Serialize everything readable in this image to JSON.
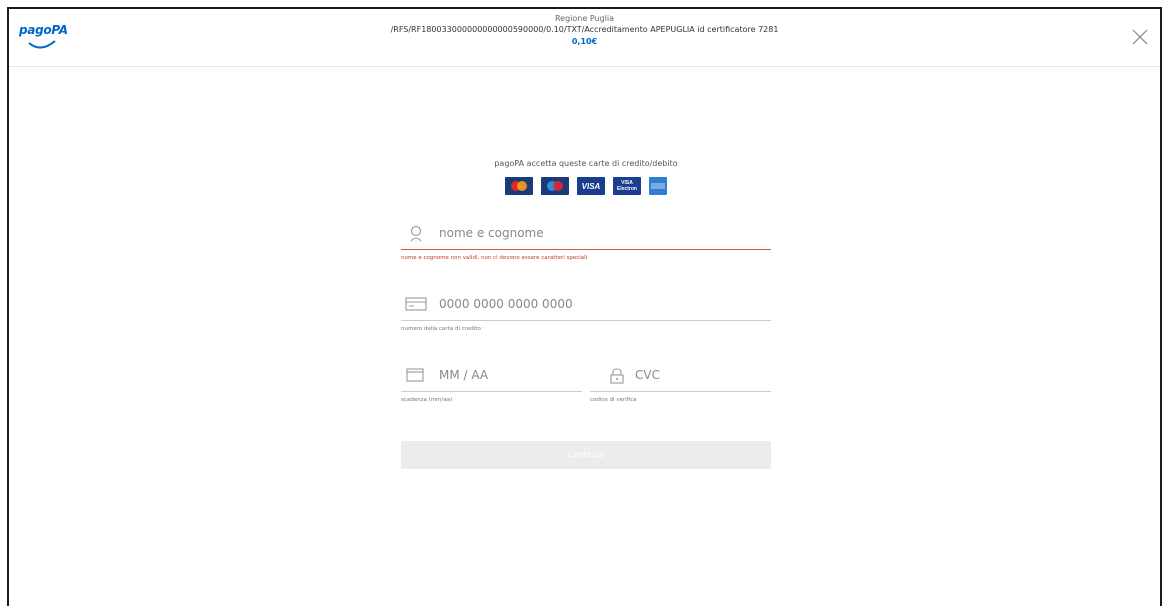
{
  "header": {
    "logo_text": "pagoPA",
    "entity": "Regione Puglia",
    "causale": "/RFS/RF180033000000000000590000/0.10/TXT/Accreditamento APEPUGLIA id certificatore 7281",
    "amount": "0,10€",
    "close_icon": "close-icon"
  },
  "form": {
    "cards_title": "pagoPA accetta queste carte di credito/debito",
    "cards": [
      {
        "name": "mastercard",
        "label": ""
      },
      {
        "name": "maestro",
        "label": ""
      },
      {
        "name": "visa",
        "label": "VISA"
      },
      {
        "name": "visa-electron",
        "label_top": "VISA",
        "label_bottom": "Electron"
      },
      {
        "name": "amex",
        "label": ""
      }
    ],
    "name_field": {
      "icon": "user-icon",
      "placeholder": "nome e cognome",
      "error": "nome e cognome non validi, non ci devono essere caratteri speciali"
    },
    "card_number_field": {
      "icon": "credit-card-icon",
      "placeholder": "0000 0000 0000 0000",
      "help": "numero della carta di credito"
    },
    "expiry_field": {
      "icon": "calendar-icon",
      "placeholder": "MM / AA",
      "help": "scadenza (mm/aa)"
    },
    "cvc_field": {
      "icon": "lock-icon",
      "placeholder": "CVC",
      "help": "codice di verifica"
    },
    "submit_label": "Continua"
  }
}
